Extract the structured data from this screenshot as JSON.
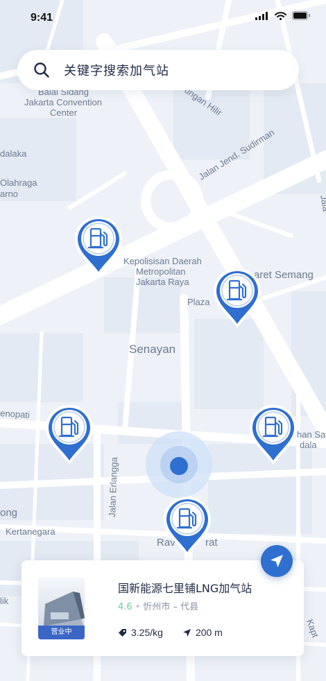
{
  "status_bar": {
    "time": "9:41"
  },
  "search": {
    "placeholder": "关键字搜索加气站"
  },
  "map_labels": [
    "Balai Sidang",
    "Jakarta Convention",
    "Center",
    "dalaka",
    "Olahraga",
    "arno",
    "Jalan Jend. Sudirman",
    "ungan Hilir",
    "Kepolisisan Daerah",
    "Metropolitan",
    "Jakarta Raya",
    "aret Semang",
    "Plaza",
    "Senayan",
    "enopati",
    "Jalan Erlangga",
    "ong",
    "Kertanegara",
    "Rav",
    "rat",
    "Jala",
    "han Satr",
    "dala",
    "lik",
    "Kapt"
  ],
  "selected_station": {
    "name": "国新能源七里铺LNG加气站",
    "rating": "4.6",
    "separator": "•",
    "location": "忻州市 – 代县",
    "status_badge": "营业中",
    "price": "3.25/kg",
    "distance": "200 m"
  },
  "colors": {
    "accent": "#2f6fd0",
    "rating": "#6dcfa0",
    "map_background": "#eef2f8",
    "road": "#ffffff",
    "block": "#e4eaf3"
  },
  "icons": [
    "search-icon",
    "gas-station-icon",
    "location-arrow-icon",
    "price-tag-icon",
    "navigation-arrow-icon",
    "signal-icon",
    "wifi-icon",
    "battery-icon"
  ]
}
